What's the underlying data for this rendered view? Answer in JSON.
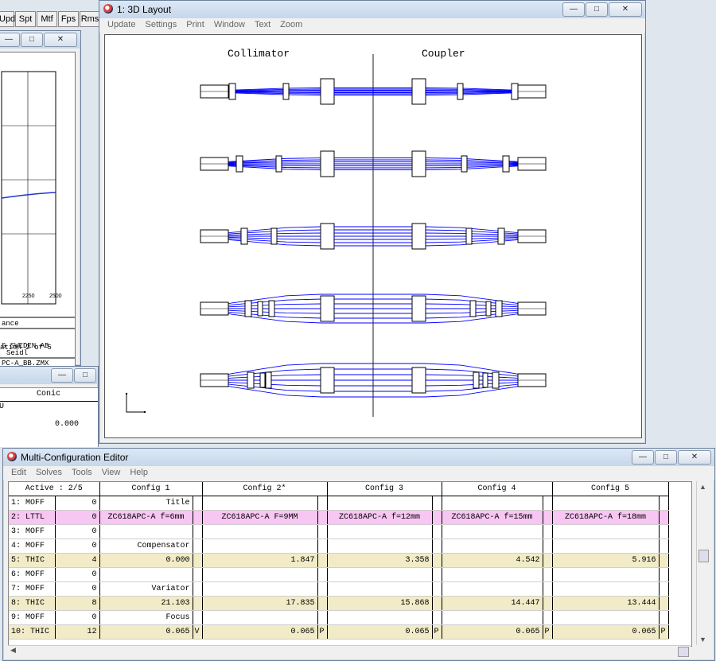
{
  "toolbar": {
    "buttons": [
      "Upd",
      "Spt",
      "Mtf",
      "Fps",
      "Rms"
    ]
  },
  "layout_window": {
    "title": "1: 3D Layout",
    "menu": [
      "Update",
      "Settings",
      "Print",
      "Window",
      "Text",
      "Zoom"
    ],
    "labels": {
      "left": "Collimator",
      "right": "Coupler"
    }
  },
  "bg_window": {
    "x_ticks": [
      "2250",
      "2500"
    ],
    "text_lines": [
      "ance",
      "S SWEDEN AB",
      "Seidl",
      "PC-A_BB.ZMX",
      "ation 2 of 5"
    ]
  },
  "bg_window2": {
    "column": "Conic",
    "cell_u": "U",
    "value": "0.000"
  },
  "mce": {
    "title": "Multi-Configuration Editor",
    "menu": [
      "Edit",
      "Solves",
      "Tools",
      "View",
      "Help"
    ],
    "active": "Active : 2/5",
    "headers": [
      "Config 1",
      "Config 2*",
      "Config 3",
      "Config 4",
      "Config 5"
    ],
    "rows": [
      {
        "op": "1: MOFF",
        "n": "0",
        "c": [
          "Title",
          "",
          "",
          "",
          ""
        ],
        "f": [
          "",
          "",
          "",
          "",
          ""
        ],
        "style": ""
      },
      {
        "op": "2: LTTL",
        "n": "0",
        "c": [
          "ZC618APC-A f=6mm",
          "ZC618APC-A F=9MM",
          "ZC618APC-A f=12mm",
          "ZC618APC-A f=15mm",
          "ZC618APC-A f=18mm"
        ],
        "f": [
          "",
          "",
          "",
          "",
          ""
        ],
        "style": "pink"
      },
      {
        "op": "3: MOFF",
        "n": "0",
        "c": [
          "",
          "",
          "",
          "",
          ""
        ],
        "f": [
          "",
          "",
          "",
          "",
          ""
        ],
        "style": ""
      },
      {
        "op": "4: MOFF",
        "n": "0",
        "c": [
          "Compensator",
          "",
          "",
          "",
          ""
        ],
        "f": [
          "",
          "",
          "",
          "",
          ""
        ],
        "style": ""
      },
      {
        "op": "5: THIC",
        "n": "4",
        "c": [
          "0.000",
          "1.847",
          "3.358",
          "4.542",
          "5.916"
        ],
        "f": [
          "",
          "",
          "",
          "",
          ""
        ],
        "style": "tan"
      },
      {
        "op": "6: MOFF",
        "n": "0",
        "c": [
          "",
          "",
          "",
          "",
          ""
        ],
        "f": [
          "",
          "",
          "",
          "",
          ""
        ],
        "style": ""
      },
      {
        "op": "7: MOFF",
        "n": "0",
        "c": [
          "Variator",
          "",
          "",
          "",
          ""
        ],
        "f": [
          "",
          "",
          "",
          "",
          ""
        ],
        "style": ""
      },
      {
        "op": "8: THIC",
        "n": "8",
        "c": [
          "21.103",
          "17.835",
          "15.868",
          "14.447",
          "13.444"
        ],
        "f": [
          "",
          "",
          "",
          "",
          ""
        ],
        "style": "tan"
      },
      {
        "op": "9: MOFF",
        "n": "0",
        "c": [
          "Focus",
          "",
          "",
          "",
          ""
        ],
        "f": [
          "",
          "",
          "",
          "",
          ""
        ],
        "style": ""
      },
      {
        "op": "10: THIC",
        "n": "12",
        "c": [
          "0.065",
          "0.065",
          "0.065",
          "0.065",
          "0.065"
        ],
        "f": [
          "V",
          "P",
          "P",
          "P",
          "P"
        ],
        "style": "tan"
      }
    ]
  },
  "colors": {
    "rays": "#0000ff",
    "pink": "#f7c6f2",
    "tan": "#f1ebc7"
  }
}
